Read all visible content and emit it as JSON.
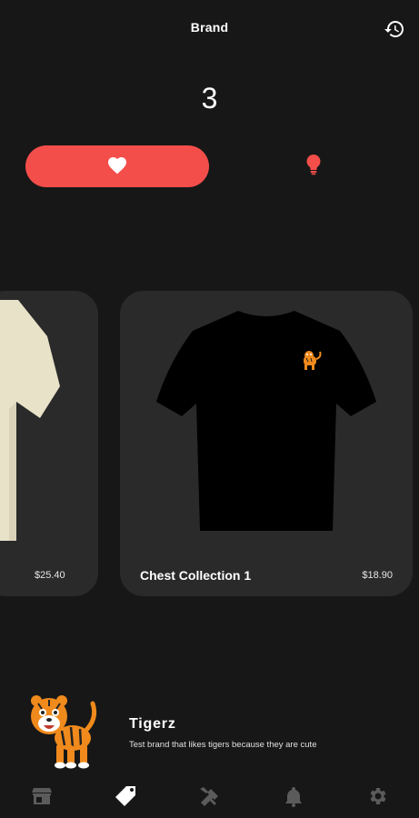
{
  "app_bar": {
    "title": "Brand",
    "history_icon": "history-icon"
  },
  "swipe_count": "3",
  "actions": {
    "like_icon": "heart-icon",
    "idea_icon": "lightbulb-icon",
    "accent_color": "#f44e4b"
  },
  "products": [
    {
      "name": "",
      "price": "$25.40",
      "shirt_color": "#e8e2c9"
    },
    {
      "name": "Chest Collection 1",
      "price": "$18.90",
      "shirt_color": "#000000"
    }
  ],
  "brand": {
    "name": "Tigerz",
    "description": "Test brand that likes tigers because they are cute"
  },
  "bottom_nav": [
    {
      "icon": "store-icon",
      "active": false
    },
    {
      "icon": "tag-icon",
      "active": true
    },
    {
      "icon": "tools-icon",
      "active": false
    },
    {
      "icon": "bell-icon",
      "active": false
    },
    {
      "icon": "gear-icon",
      "active": false
    }
  ]
}
